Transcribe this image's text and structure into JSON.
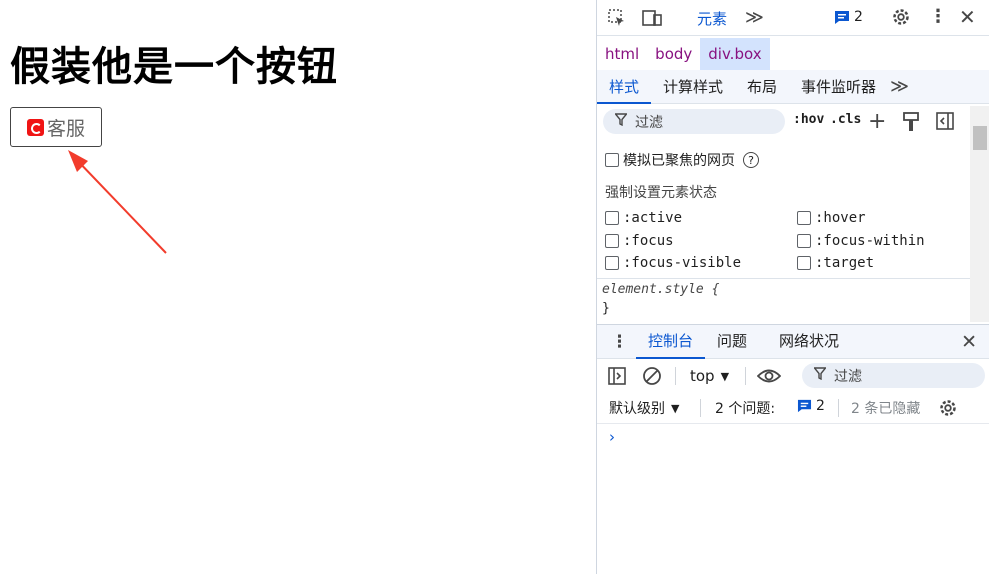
{
  "page": {
    "heading": "假装他是一个按钮",
    "button_label": "客服"
  },
  "devtools": {
    "main_tab": "元素",
    "issue_count": "2",
    "breadcrumbs": [
      "html",
      "body",
      "div.box"
    ],
    "subtabs": [
      "样式",
      "计算样式",
      "布局",
      "事件监听器"
    ],
    "filter_placeholder": "过滤",
    "hov": ":hov",
    "cls": ".cls",
    "emulate_focus": "模拟已聚焦的网页",
    "force_state_title": "强制设置元素状态",
    "states_left": [
      ":active",
      ":focus",
      ":focus-visible"
    ],
    "states_right": [
      ":hover",
      ":focus-within",
      ":target"
    ],
    "element_style_open": "element.style {",
    "element_style_close": "}",
    "drawer_tabs": [
      "控制台",
      "问题",
      "网络状况"
    ],
    "context": "top",
    "console_filter": "过滤",
    "level": "默认级别",
    "issues_label": "2 个问题:",
    "issues_count": "2",
    "hidden_label": "2 条已隐藏",
    "accent": "#0b57d0"
  }
}
